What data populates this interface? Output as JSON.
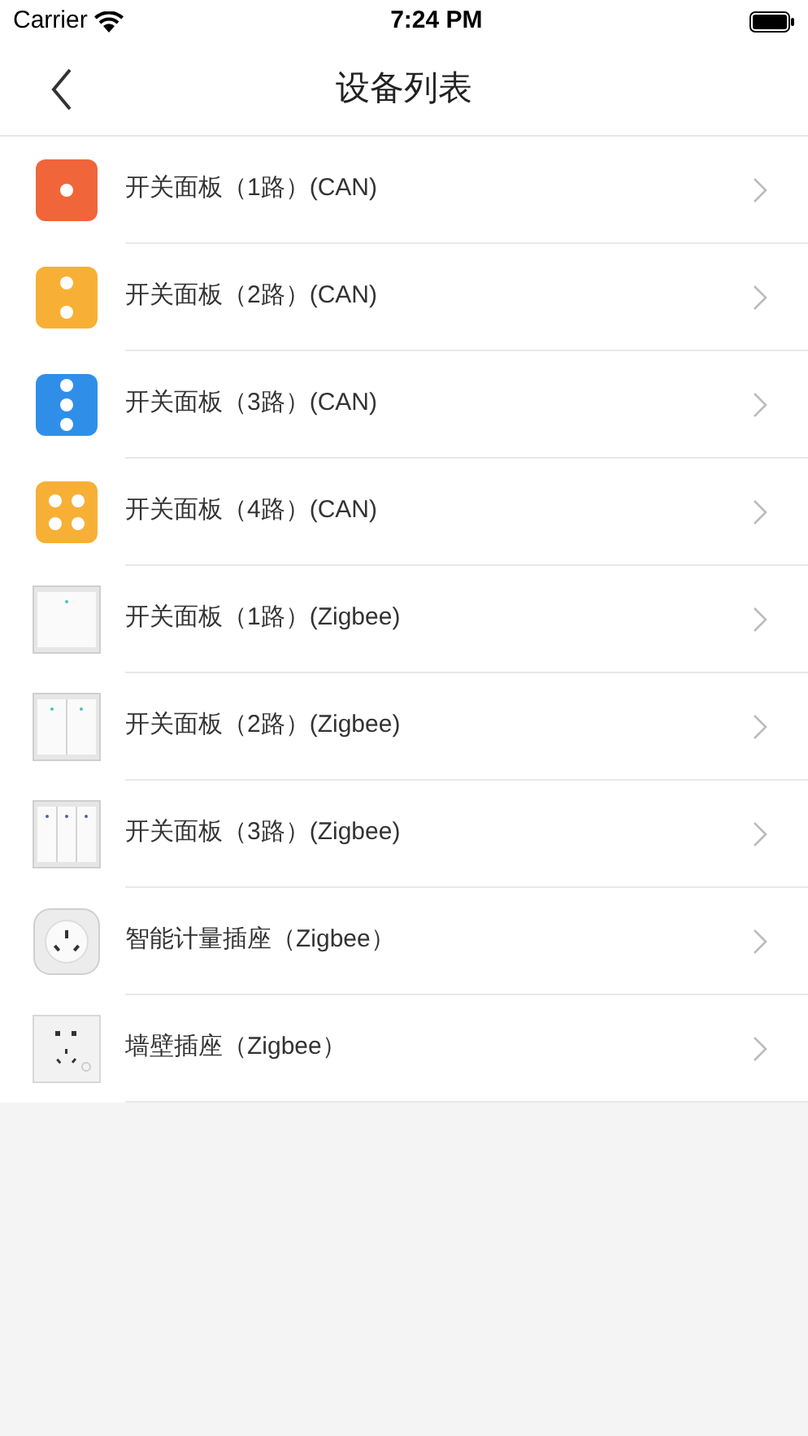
{
  "status_bar": {
    "carrier": "Carrier",
    "time": "7:24 PM"
  },
  "header": {
    "title": "设备列表"
  },
  "devices": [
    {
      "name": "开关面板（1路）(CAN)",
      "kind": "panel1",
      "color": "#f0663a"
    },
    {
      "name": "开关面板（2路）(CAN)",
      "kind": "panel2",
      "color": "#f7b035"
    },
    {
      "name": "开关面板（3路）(CAN)",
      "kind": "panel3",
      "color": "#2f8fe8"
    },
    {
      "name": "开关面板（4路）(CAN)",
      "kind": "panel4",
      "color": "#f7b035"
    },
    {
      "name": "开关面板（1路）(Zigbee)",
      "kind": "switch1"
    },
    {
      "name": "开关面板（2路）(Zigbee)",
      "kind": "switch2"
    },
    {
      "name": "开关面板（3路）(Zigbee)",
      "kind": "switch3"
    },
    {
      "name": "智能计量插座（Zigbee）",
      "kind": "plug"
    },
    {
      "name": "墙壁插座（Zigbee）",
      "kind": "socket"
    }
  ]
}
